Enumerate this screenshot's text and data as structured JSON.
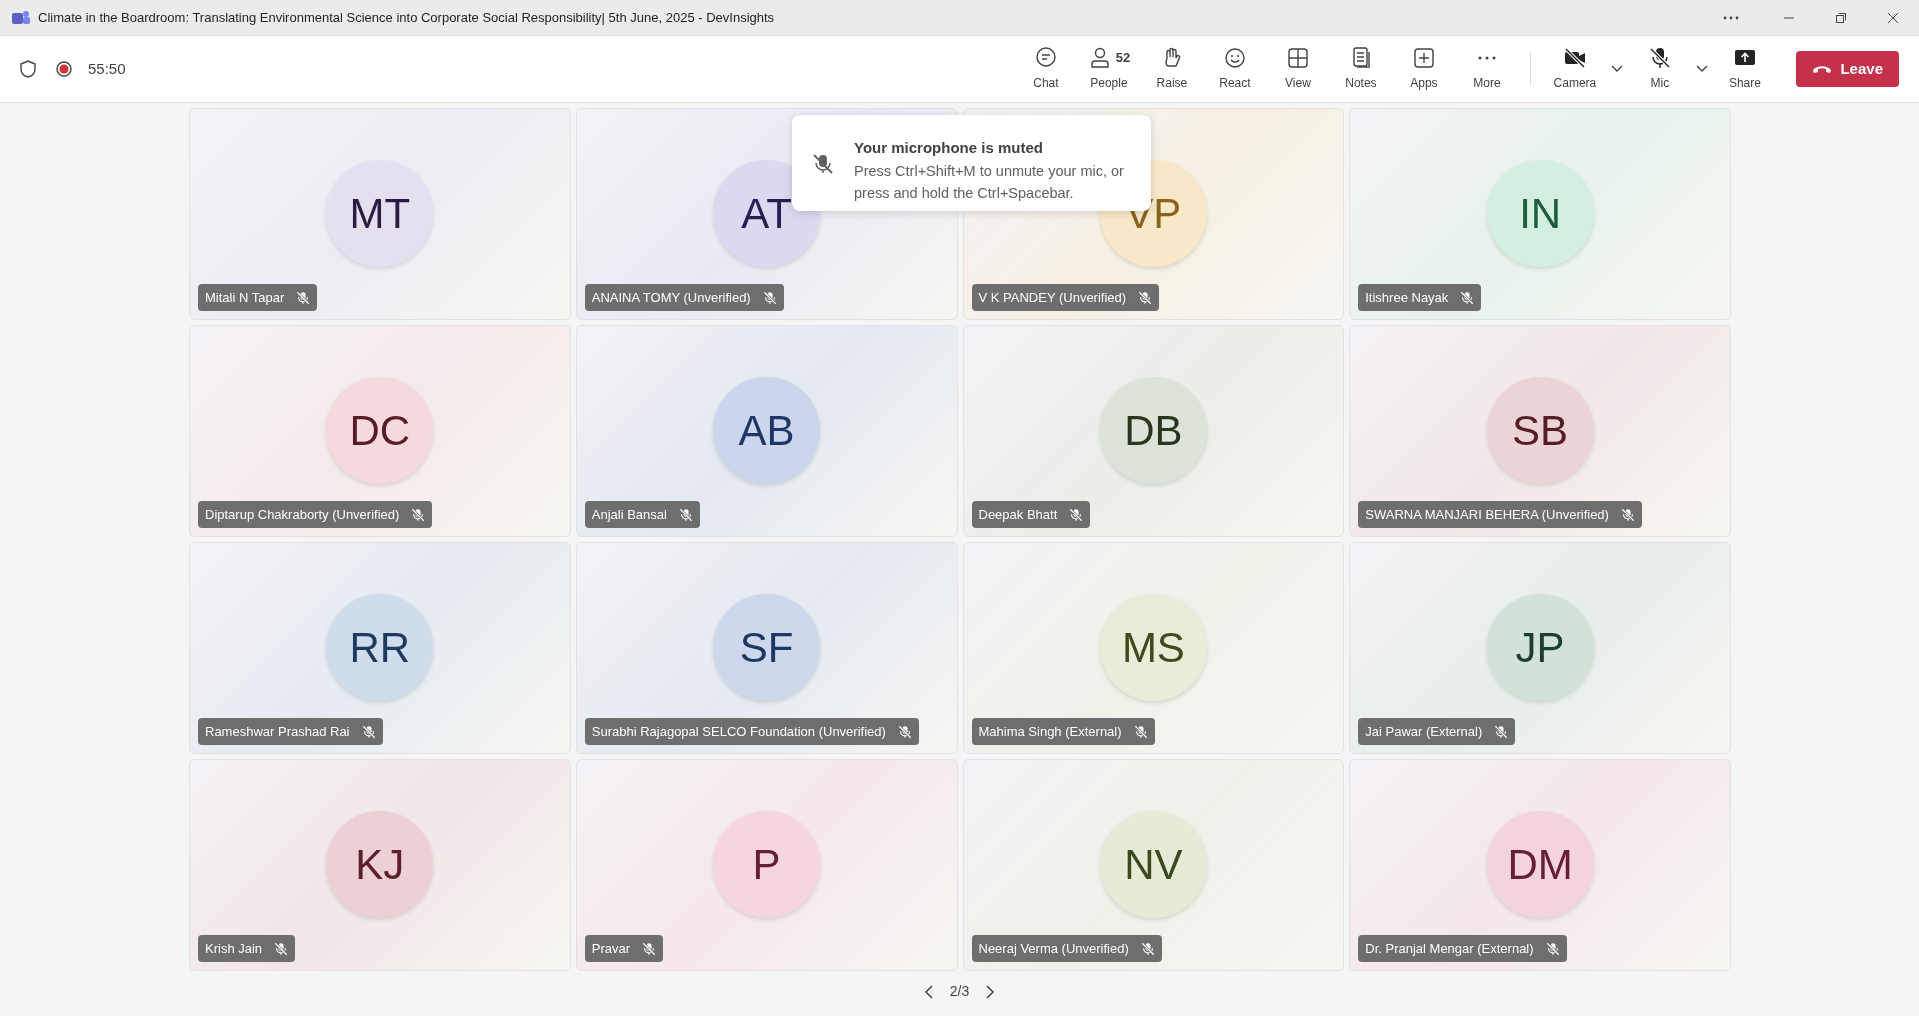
{
  "window": {
    "title": "Climate in the Boardroom: Translating Environmental Science into Corporate Social Responsibility| 5th June, 2025 - DevInsights"
  },
  "meeting": {
    "recording": true,
    "timer": "55:50"
  },
  "toolbar": [
    {
      "kind": "chat",
      "label": "Chat"
    },
    {
      "kind": "people",
      "label": "People",
      "count": "52"
    },
    {
      "kind": "raise",
      "label": "Raise"
    },
    {
      "kind": "react",
      "label": "React"
    },
    {
      "kind": "view",
      "label": "View"
    },
    {
      "kind": "notes",
      "label": "Notes"
    },
    {
      "kind": "apps",
      "label": "Apps"
    },
    {
      "kind": "more",
      "label": "More"
    },
    {
      "kind": "camera",
      "label": "Camera",
      "off": true
    },
    {
      "kind": "mic",
      "label": "Mic",
      "off": true
    },
    {
      "kind": "share",
      "label": "Share"
    }
  ],
  "leave_button": {
    "label": "Leave"
  },
  "toast": {
    "title": "Your microphone is muted",
    "body": "Press Ctrl+Shift+M to unmute your mic, or press and hold the Ctrl+Spacebar."
  },
  "tiles": [
    {
      "initials": "MT",
      "name": "Mitali N Tapar",
      "muted": true,
      "color": "#e5e0f0"
    },
    {
      "initials": "AT",
      "name": "ANAINA TOMY (Unverified)",
      "muted": true,
      "color": "#dcd8f0"
    },
    {
      "initials": "VP",
      "name": "V K PANDEY (Unverified)",
      "muted": true,
      "color": "#f8e8c8"
    },
    {
      "initials": "IN",
      "name": "Itishree Nayak",
      "muted": true,
      "color": "#d3efe0"
    },
    {
      "initials": "DC",
      "name": "Diptarup Chakraborty (Unverified)",
      "muted": true,
      "color": "#f5dadd"
    },
    {
      "initials": "AB",
      "name": "Anjali Bansal",
      "muted": true,
      "color": "#cbd6ec"
    },
    {
      "initials": "DB",
      "name": "Deepak Bhatt",
      "muted": true,
      "color": "#dde3d8"
    },
    {
      "initials": "SB",
      "name": "SWARNA MANJARI BEHERA (Unverified)",
      "muted": true,
      "color": "#ecd3d6"
    },
    {
      "initials": "RR",
      "name": "Rameshwar Prashad Rai",
      "muted": true,
      "color": "#cfdcec"
    },
    {
      "initials": "SF",
      "name": "Surabhi Rajagopal SELCO Foundation (Unverified)",
      "muted": true,
      "color": "#cdd8ec"
    },
    {
      "initials": "MS",
      "name": "Mahima Singh (External)",
      "muted": true,
      "color": "#e8ecd8"
    },
    {
      "initials": "JP",
      "name": "Jai Pawar (External)",
      "muted": true,
      "color": "#d3e2d9"
    },
    {
      "initials": "KJ",
      "name": "Krish Jain",
      "muted": true,
      "color": "#ecd0d5"
    },
    {
      "initials": "P",
      "name": "Pravar",
      "muted": true,
      "color": "#f5d5e0"
    },
    {
      "initials": "NV",
      "name": "Neeraj Verma (Unverified)",
      "muted": true,
      "color": "#e6ebd8"
    },
    {
      "initials": "DM",
      "name": "Dr. Pranjal Mengar (External)",
      "muted": true,
      "color": "#f3d3de"
    }
  ],
  "pager": {
    "label": "2/3"
  }
}
